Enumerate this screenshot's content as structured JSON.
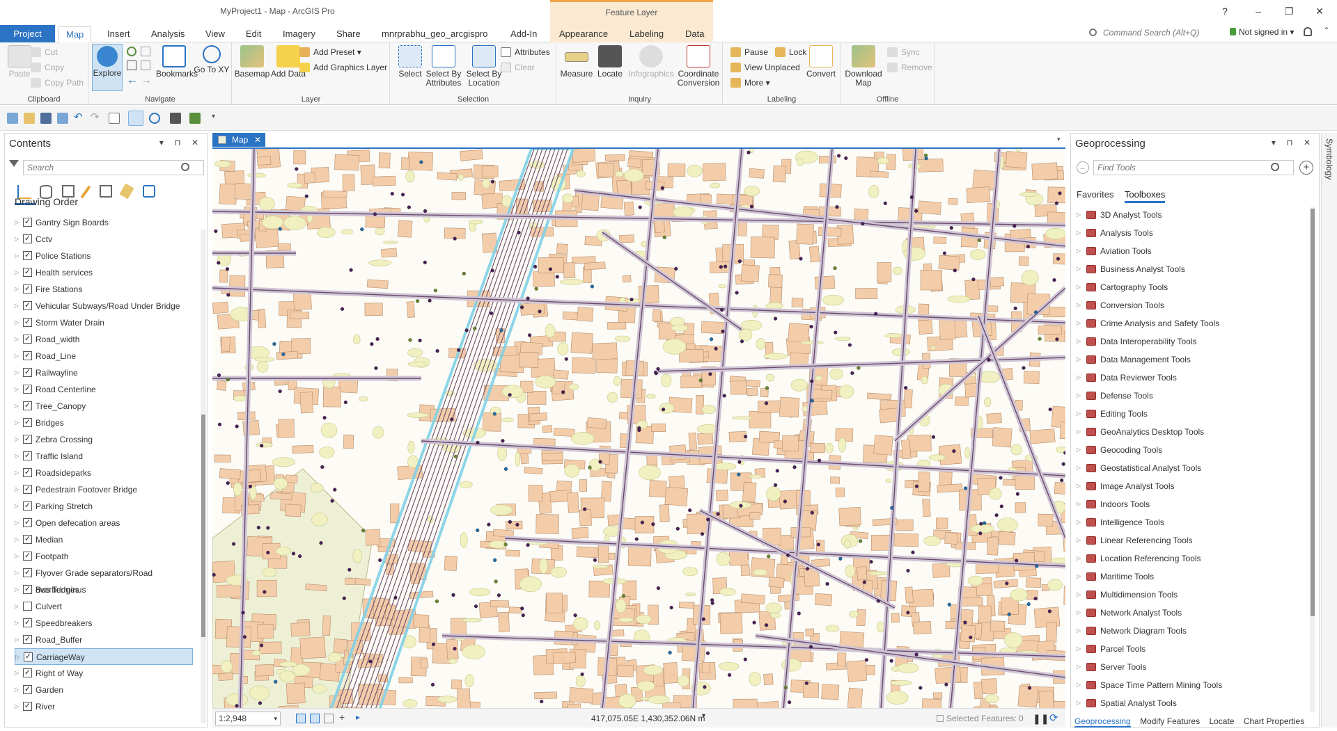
{
  "window": {
    "title": "MyProject1 - Map - ArcGIS Pro",
    "context_tab_group": "Feature Layer",
    "help": "?",
    "minimize": "–",
    "restore": "❐",
    "close": "✕"
  },
  "tabs": {
    "project": "Project",
    "items": [
      "Map",
      "Insert",
      "Analysis",
      "View",
      "Edit",
      "Imagery",
      "Share",
      "mnrprabhu_geo_arcgispro",
      "Add-In",
      "Appearance",
      "Labeling",
      "Data"
    ],
    "command_search": "Command Search (Alt+Q)",
    "signin": "Not signed in ▾"
  },
  "ribbon": {
    "clipboard": {
      "label": "Clipboard",
      "paste": "Paste",
      "cut": "Cut",
      "copy": "Copy",
      "copy_path": "Copy Path"
    },
    "navigate": {
      "label": "Navigate",
      "explore": "Explore",
      "bookmarks": "Bookmarks",
      "goto_xy": "Go To XY"
    },
    "layer": {
      "label": "Layer",
      "basemap": "Basemap",
      "add_data": "Add Data",
      "add_preset": "Add Preset ▾",
      "add_graphics": "Add Graphics Layer"
    },
    "selection": {
      "label": "Selection",
      "select": "Select",
      "select_by_attr": "Select By Attributes",
      "select_by_loc": "Select By Location",
      "attributes": "Attributes",
      "clear": "Clear"
    },
    "inquiry": {
      "label": "Inquiry",
      "measure": "Measure",
      "locate": "Locate",
      "infographics": "Infographics",
      "coord_conv": "Coordinate Conversion"
    },
    "labeling": {
      "label": "Labeling",
      "pause": "Pause",
      "lock": "Lock",
      "view_unplaced": "View Unplaced",
      "more": "More ▾",
      "convert": "Convert"
    },
    "offline": {
      "label": "Offline",
      "download_map": "Download Map",
      "sync": "Sync",
      "remove": "Remove"
    }
  },
  "contents": {
    "title": "Contents",
    "search_placeholder": "Search",
    "drawing_order": "Drawing Order",
    "layers": [
      {
        "name": "Gantry Sign Boards",
        "checked": true
      },
      {
        "name": "Cctv",
        "checked": true
      },
      {
        "name": "Police Stations",
        "checked": true
      },
      {
        "name": "Health services",
        "checked": true
      },
      {
        "name": "Fire Stations",
        "checked": true
      },
      {
        "name": "Vehicular Subways/Road Under Bridge",
        "checked": true
      },
      {
        "name": "Storm Water Drain",
        "checked": true
      },
      {
        "name": "Road_width",
        "checked": true
      },
      {
        "name": "Road_Line",
        "checked": true
      },
      {
        "name": "Railwayline",
        "checked": true
      },
      {
        "name": "Road Centerline",
        "checked": true
      },
      {
        "name": "Tree_Canopy",
        "checked": true
      },
      {
        "name": "Bridges",
        "checked": true
      },
      {
        "name": "Zebra Crossing",
        "checked": true
      },
      {
        "name": "Traffic Island",
        "checked": true
      },
      {
        "name": "Roadsideparks",
        "checked": true
      },
      {
        "name": "Pedestrain Footover Bridge",
        "checked": true
      },
      {
        "name": "Parking Stretch",
        "checked": true
      },
      {
        "name": "Open defecation areas",
        "checked": true
      },
      {
        "name": "Median",
        "checked": true
      },
      {
        "name": "Footpath",
        "checked": true
      },
      {
        "name": "Flyover Grade separators/Road overbridges",
        "checked": true
      },
      {
        "name": "Bus Terminus",
        "checked": true
      },
      {
        "name": "Culvert",
        "checked": false
      },
      {
        "name": "Speedbreakers",
        "checked": true
      },
      {
        "name": "Road_Buffer",
        "checked": true
      },
      {
        "name": "CarriageWay",
        "checked": true,
        "selected": true
      },
      {
        "name": "Right of Way",
        "checked": true
      },
      {
        "name": "Garden",
        "checked": true
      },
      {
        "name": "River",
        "checked": true
      }
    ]
  },
  "map": {
    "tab_label": "Map",
    "scale": "1:2,948",
    "coordinates": "417,075.05E 1,430,352.06N m",
    "selected_features": "Selected Features: 0"
  },
  "geoprocessing": {
    "title": "Geoprocessing",
    "search_placeholder": "Find Tools",
    "tab_favorites": "Favorites",
    "tab_toolboxes": "Toolboxes",
    "toolboxes": [
      "3D Analyst Tools",
      "Analysis Tools",
      "Aviation Tools",
      "Business Analyst Tools",
      "Cartography Tools",
      "Conversion Tools",
      "Crime Analysis and Safety Tools",
      "Data Interoperability Tools",
      "Data Management Tools",
      "Data Reviewer Tools",
      "Defense Tools",
      "Editing Tools",
      "GeoAnalytics Desktop Tools",
      "Geocoding Tools",
      "Geostatistical Analyst Tools",
      "Image Analyst Tools",
      "Indoors Tools",
      "Intelligence Tools",
      "Linear Referencing Tools",
      "Location Referencing Tools",
      "Maritime Tools",
      "Multidimension Tools",
      "Network Analyst Tools",
      "Network Diagram Tools",
      "Parcel Tools",
      "Server Tools",
      "Space Time Pattern Mining Tools",
      "Spatial Analyst Tools"
    ],
    "bottom_tabs": [
      "Geoprocessing",
      "Modify Features",
      "Locate",
      "Chart Properties"
    ]
  },
  "symbology_strip": "Symbology",
  "colors": {
    "accent": "#2b73c4",
    "building": "#f3cda9",
    "tree": "#f0f0c0",
    "road": "#6b4a6a",
    "water": "#7fd0e8"
  }
}
